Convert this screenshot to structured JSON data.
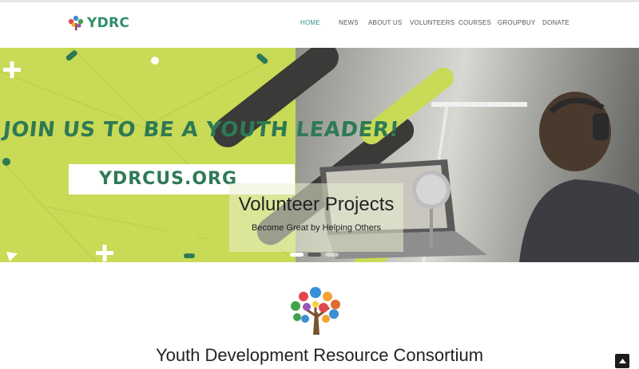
{
  "header": {
    "logo_text": "YDRC",
    "nav": [
      {
        "label": "HOME",
        "active": true
      },
      {
        "label": "NEWS",
        "active": false
      },
      {
        "label": "ABOUT US",
        "active": false
      },
      {
        "label": "VOLUNTEERS",
        "active": false
      },
      {
        "label": "COURSES",
        "active": false
      },
      {
        "label": "GROUPBUY",
        "active": false
      },
      {
        "label": "DONATE",
        "active": false
      }
    ]
  },
  "hero": {
    "headline": "JOIN US TO BE A YOUTH LEADER!",
    "url_text": "YDRCUS.ORG",
    "caption_title": "Volunteer Projects",
    "caption_subtitle": "Become Great by Helping Others",
    "slide_count": 3,
    "active_slide": 1
  },
  "main": {
    "site_title": "Youth Development Resource Consortium"
  },
  "colors": {
    "brand_green": "#2f8f6a",
    "hero_lime": "#c9da56",
    "nav_active": "#2f8f8a"
  },
  "icons": {
    "back_to_top": "chevron-up-icon",
    "logo": "tree-logo-icon"
  }
}
